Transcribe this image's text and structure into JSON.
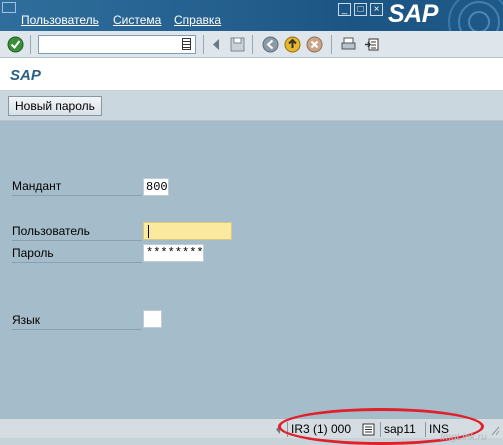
{
  "menu": {
    "items": [
      "Пользователь",
      "Система",
      "Справка"
    ]
  },
  "window_buttons": [
    "_",
    "□",
    "×"
  ],
  "logo": {
    "text": "SAP"
  },
  "toolbar": {
    "command_value": "",
    "icons": [
      "enter-icon",
      "command-field-icon",
      "back-icon",
      "save-icon",
      "back-arrow-icon",
      "exit-icon",
      "cancel-icon",
      "print-icon",
      "find-icon"
    ]
  },
  "title": "SAP",
  "app_toolbar": {
    "new_password_label": "Новый пароль"
  },
  "form": {
    "client": {
      "label": "Мандант",
      "value": "800"
    },
    "user": {
      "label": "Пользователь",
      "value": ""
    },
    "password": {
      "label": "Пароль",
      "value": "********"
    },
    "language": {
      "label": "Язык",
      "value": ""
    }
  },
  "status": {
    "system": "IR3 (1) 000",
    "server": "sap11",
    "mode": "INS"
  },
  "watermark": "ImgLink.ru",
  "colors": {
    "accent": "#2c5f88",
    "highlight": "#e0202a",
    "focus_field": "#fbe9a0"
  }
}
